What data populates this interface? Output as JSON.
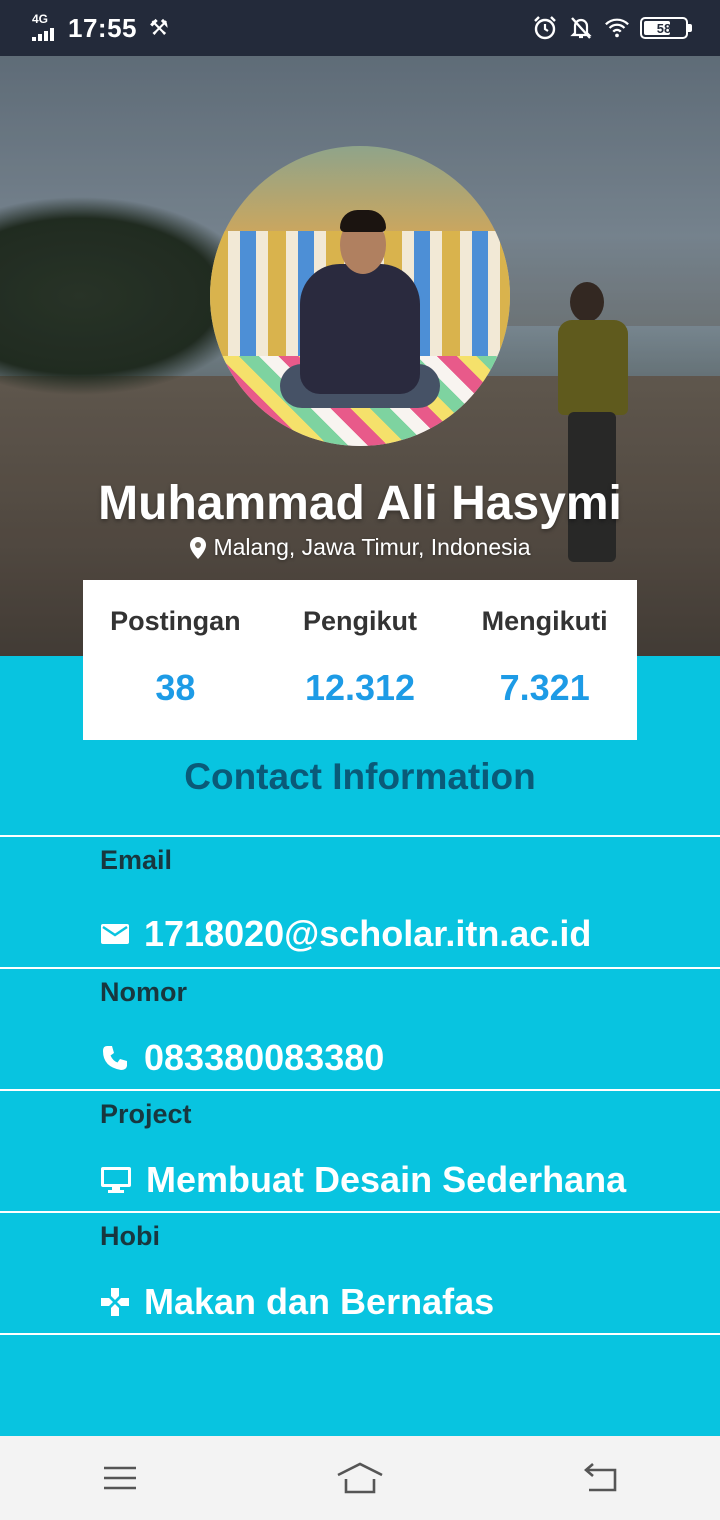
{
  "status_bar": {
    "network": "4G",
    "time": "17:55",
    "battery": "58",
    "battery_level": 0.58
  },
  "profile": {
    "name": "Muhammad Ali Hasymi",
    "location": "Malang, Jawa Timur, Indonesia"
  },
  "stats": [
    {
      "label": "Postingan",
      "value": "38"
    },
    {
      "label": "Pengikut",
      "value": "12.312"
    },
    {
      "label": "Mengikuti",
      "value": "7.321"
    }
  ],
  "contact": {
    "title": "Contact Information",
    "rows": [
      {
        "label": "Email",
        "value": "1718020@scholar.itn.ac.id",
        "icon": "email-icon"
      },
      {
        "label": "Nomor",
        "value": "083380083380",
        "icon": "phone-icon"
      },
      {
        "label": "Project",
        "value": "Membuat Desain Sederhana",
        "icon": "desktop-icon"
      },
      {
        "label": "Hobi",
        "value": "Makan dan Bernafas",
        "icon": "gamepad-icon"
      }
    ]
  },
  "colors": {
    "accent": "#08c4e0",
    "stat_value": "#1d9be6",
    "title": "#0a5a78",
    "status_bar": "#232a3a"
  },
  "nav": {
    "icons": [
      "menu-icon",
      "home-icon",
      "back-icon"
    ]
  }
}
